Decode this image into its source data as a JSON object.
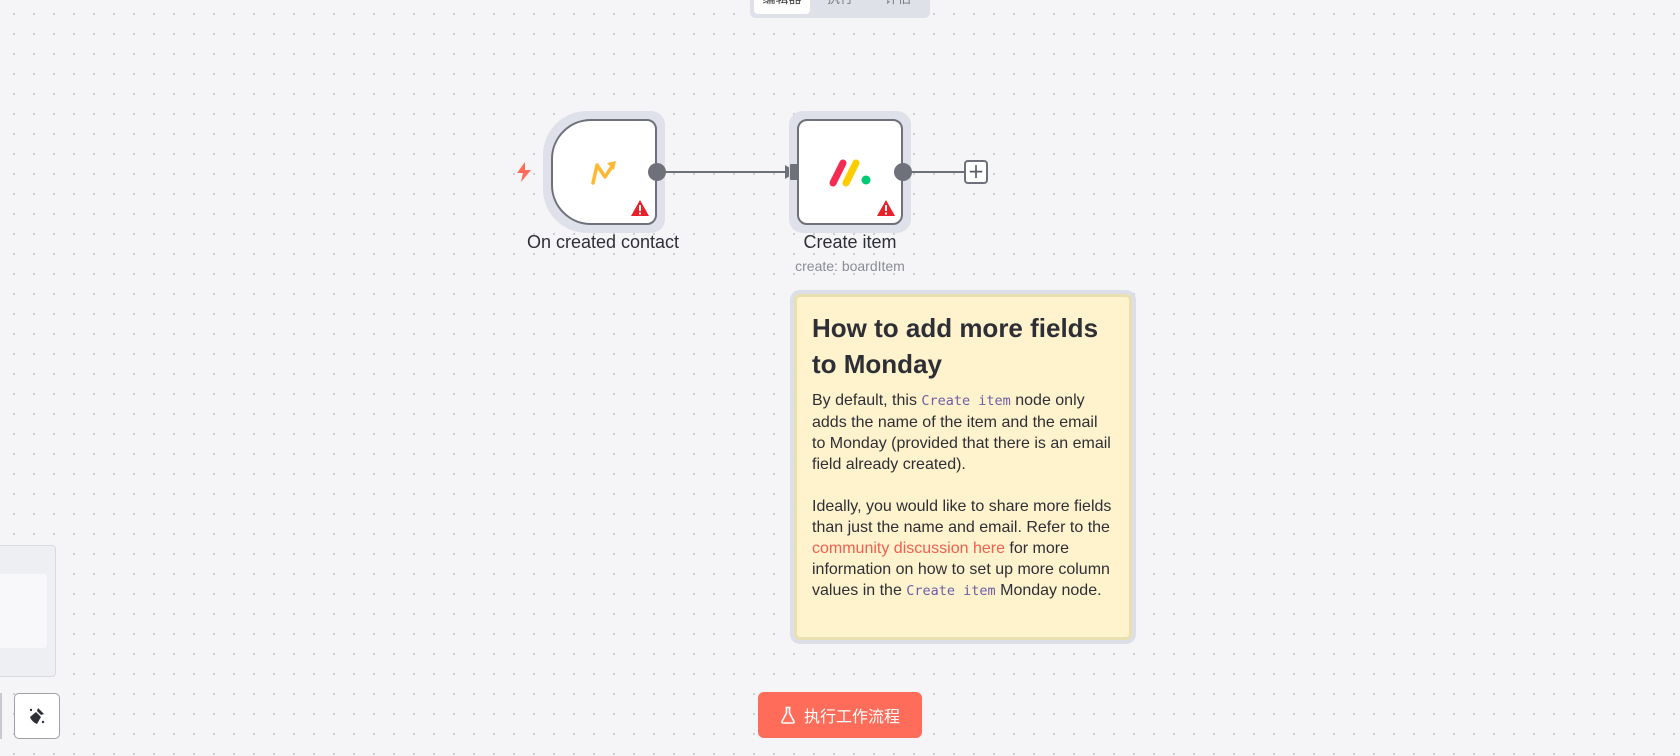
{
  "tabs": [
    {
      "label": "编辑器",
      "active": true
    },
    {
      "label": "执行",
      "active": false
    },
    {
      "label": "评估",
      "active": false
    }
  ],
  "nodes": {
    "trigger": {
      "label": "On created contact",
      "icon": "mautic-icon",
      "warning": true
    },
    "action": {
      "label": "Create item",
      "subtitle": "create: boardItem",
      "icon": "monday-icon",
      "warning": true
    }
  },
  "sticky": {
    "title": "How to add more fields to Monday",
    "p1_pre": "By default, this ",
    "p1_code": "Create item",
    "p1_post": " node only adds the name of the item and the email to Monday (provided that there is an email field already created).",
    "p2_pre": "Ideally, you would like to share more fields than just the name and email. Refer to the ",
    "p2_link": "community discussion here",
    "p2_mid": " for more information on how to set up more column values in the ",
    "p2_code": "Create item",
    "p2_post": " Monday node."
  },
  "execute_button": {
    "label": "执行工作流程",
    "icon": "flask-icon"
  },
  "colors": {
    "accent": "#ff6d5a",
    "sticky_bg": "#fef3cd",
    "warning": "#e8202a",
    "mautic": "#fdb933"
  }
}
